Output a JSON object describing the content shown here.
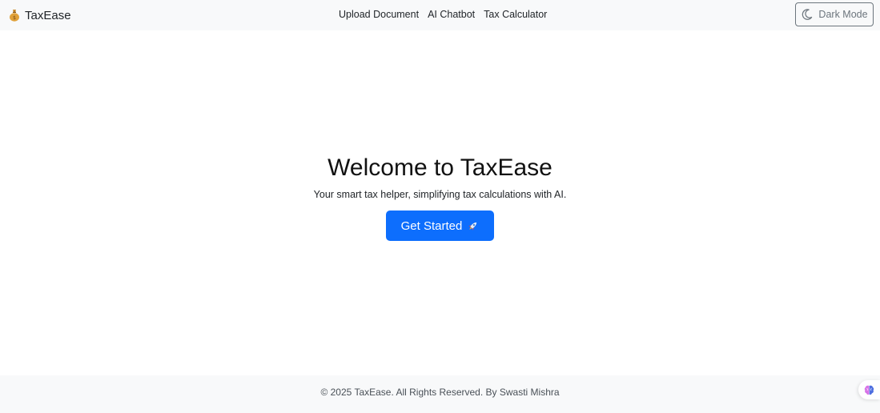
{
  "navbar": {
    "brand": "TaxEase",
    "brand_icon": "money-bag-icon",
    "links": [
      {
        "label": "Upload Document"
      },
      {
        "label": "AI Chatbot"
      },
      {
        "label": "Tax Calculator"
      }
    ],
    "dark_mode_label": "Dark Mode",
    "dark_mode_icon": "moon-icon"
  },
  "hero": {
    "title": "Welcome to TaxEase",
    "subtitle": "Your smart tax helper, simplifying tax calculations with AI.",
    "cta_label": "Get Started",
    "cta_icon": "rocket-icon"
  },
  "footer": {
    "text": "© 2025 TaxEase. All Rights Reserved. By Swasti Mishra"
  },
  "floating": {
    "icon": "brain-icon"
  },
  "colors": {
    "primary": "#0d6efd",
    "nav_bg": "#f8f9fa",
    "secondary": "#6c757d"
  }
}
